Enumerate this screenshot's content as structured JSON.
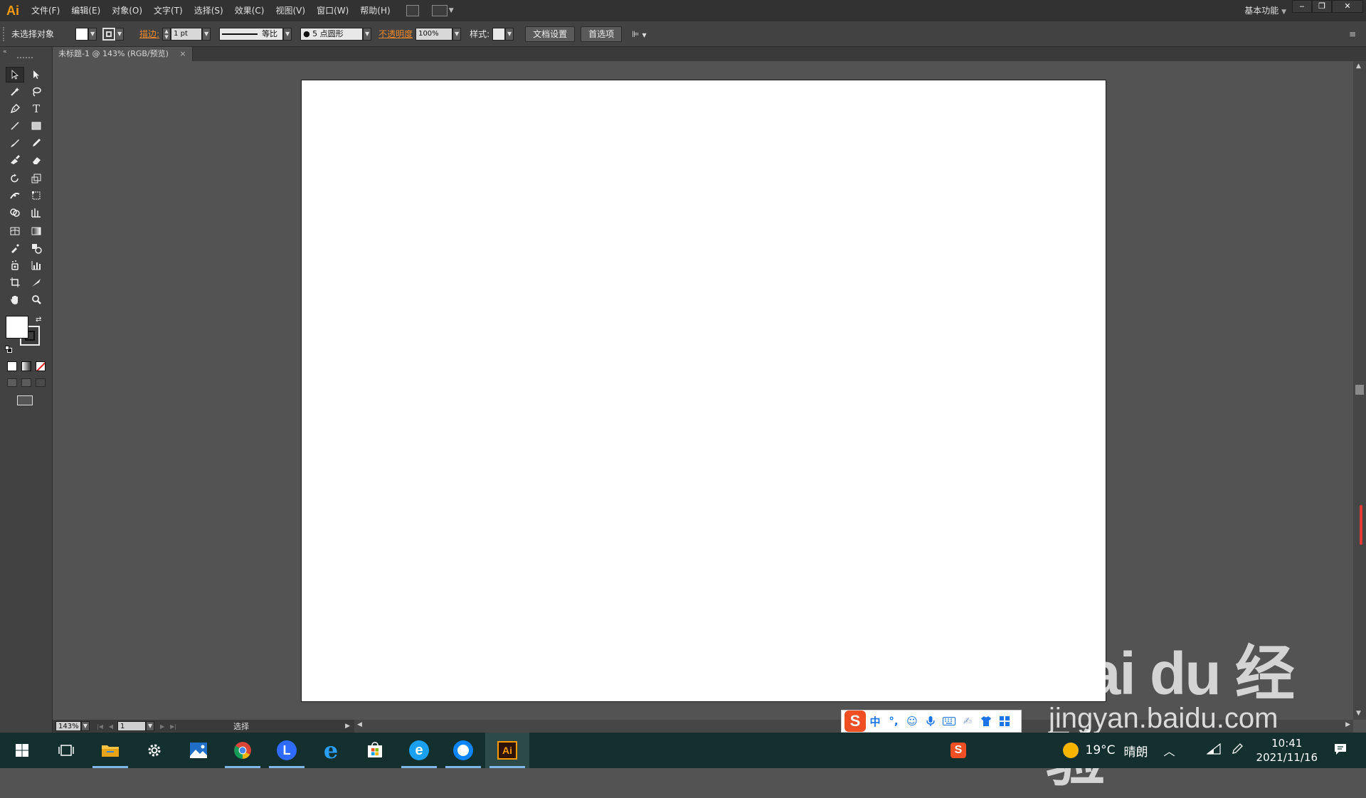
{
  "app": {
    "logo": "Ai",
    "workspace": "基本功能"
  },
  "menu": [
    "文件(F)",
    "编辑(E)",
    "对象(O)",
    "文字(T)",
    "选择(S)",
    "效果(C)",
    "视图(V)",
    "窗口(W)",
    "帮助(H)"
  ],
  "window_controls": {
    "minimize": "‒",
    "restore": "❐",
    "close": "✕"
  },
  "control_bar": {
    "selection_label": "未选择对象",
    "stroke_label": "描边:",
    "stroke_weight": "1 pt",
    "profile_label": "等比",
    "brush_label": "5 点圆形",
    "opacity_label": "不透明度",
    "opacity_value": "100%",
    "style_label": "样式:",
    "doc_setup_button": "文档设置",
    "prefs_button": "首选项"
  },
  "document_tab": {
    "title": "未标题-1 @ 143% (RGB/预览)",
    "close": "×"
  },
  "status_bar": {
    "zoom": "143%",
    "page": "1",
    "tool": "选择"
  },
  "taskbar": {
    "weather_temp": "19°C",
    "weather_desc": "晴朗",
    "time": "10:41",
    "date": "2021/11/16",
    "ai_label": "Ai"
  },
  "ime": {
    "lang": "中",
    "punct": "°,"
  },
  "watermark": {
    "brand": "Bai du 经验",
    "url": "jingyan.baidu.com"
  },
  "colors": {
    "ai_orange": "#ff9a00",
    "fill_swatch": "#ffffff",
    "taskbar_bg": "#13302e"
  }
}
